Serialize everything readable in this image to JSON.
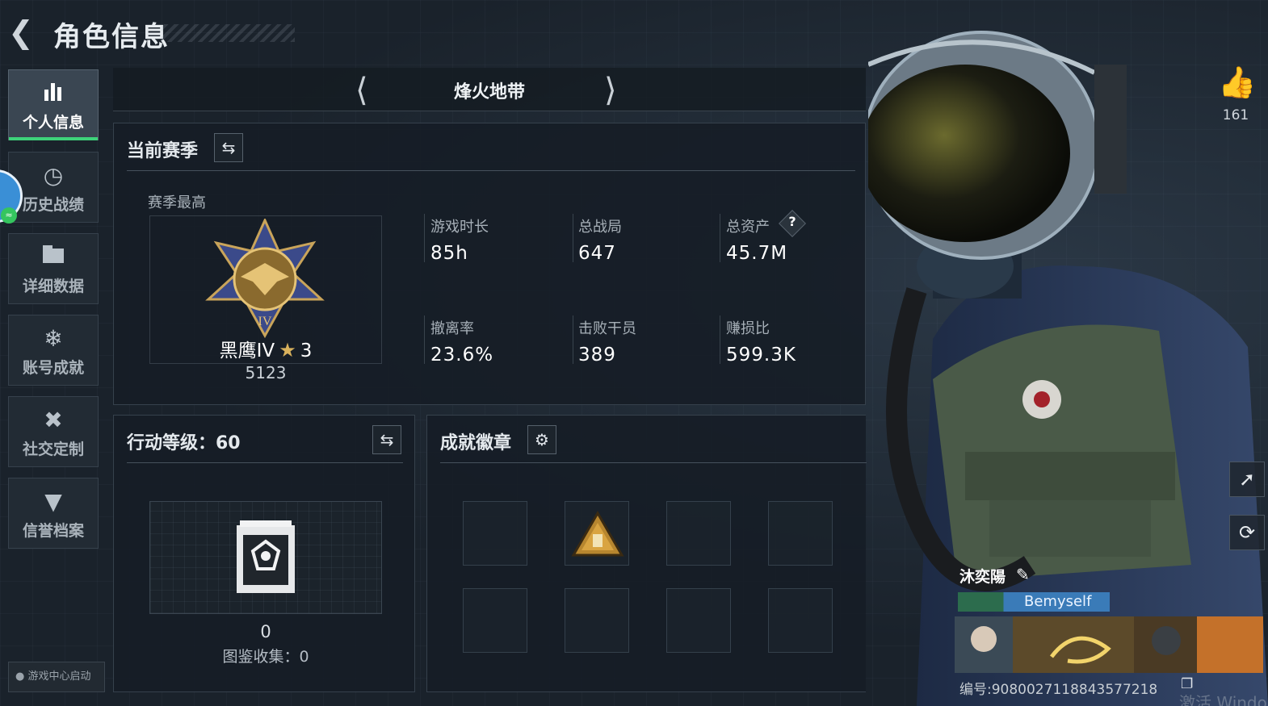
{
  "header": {
    "back_icon": "back-arrow-icon",
    "title": "角色信息"
  },
  "nav": {
    "items": [
      {
        "label": "个人信息",
        "icon": "bar-chart-icon",
        "active": true
      },
      {
        "label": "历史战绩",
        "icon": "clock-icon",
        "active": false
      },
      {
        "label": "详细数据",
        "icon": "folder-icon",
        "active": false
      },
      {
        "label": "账号成就",
        "icon": "achievement-icon",
        "active": false
      },
      {
        "label": "社交定制",
        "icon": "tools-icon",
        "active": false
      },
      {
        "label": "信誉档案",
        "icon": "credit-shield-icon",
        "active": false
      }
    ],
    "launch_label": "游戏中心启动"
  },
  "mode": {
    "title": "烽火地带"
  },
  "season": {
    "title": "当前赛季",
    "best_label": "赛季最高",
    "rank_name": "黑鹰IV",
    "rank_star_level": "3",
    "rank_score": "5123",
    "stats": [
      {
        "label": "游戏时长",
        "value": "85h"
      },
      {
        "label": "总战局",
        "value": "647"
      },
      {
        "label": "总资产",
        "value": "45.7M",
        "help": "?"
      },
      {
        "label": "撤离率",
        "value": "23.6%"
      },
      {
        "label": "击败干员",
        "value": "389"
      },
      {
        "label": "赚损比",
        "value": "599.3K"
      }
    ]
  },
  "action": {
    "title": "行动等级：60",
    "count": "0",
    "collection_label": "图鉴收集：0"
  },
  "achievement": {
    "title": "成就徽章"
  },
  "profile": {
    "likes": "161",
    "name": "沐奕陽",
    "tag": "Bemyself",
    "id_text": "编号:9080027118843577218",
    "watermark": "激活 Windo"
  },
  "colors": {
    "accent_green": "#3ed37a",
    "background": "#1a222b",
    "tag_blue": "#3a7bb8"
  }
}
